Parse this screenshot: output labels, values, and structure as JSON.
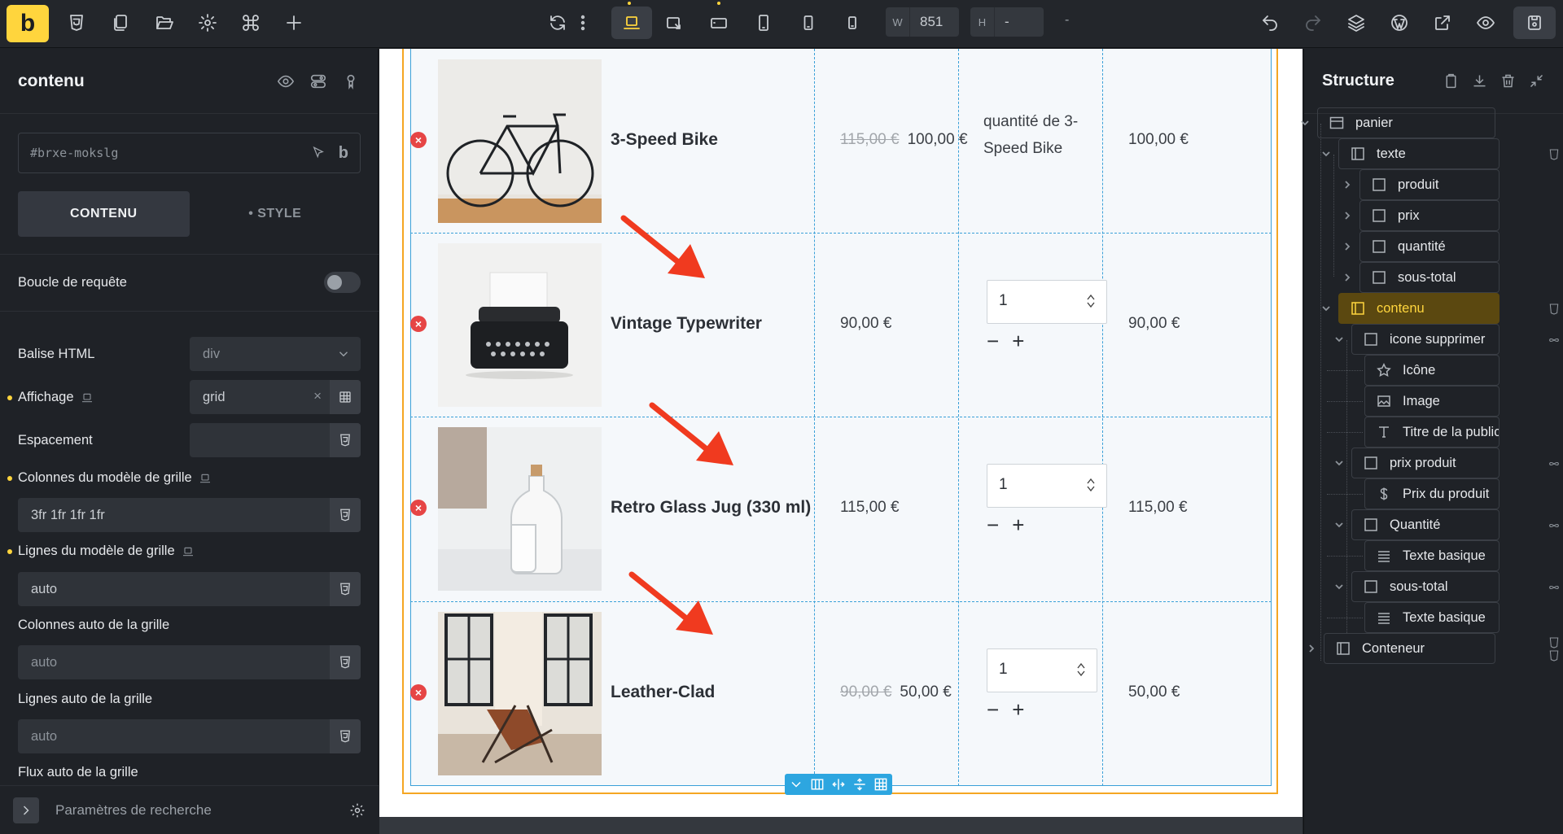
{
  "topbar": {
    "logo": "b",
    "width_key": "W",
    "width_value": "851",
    "height_key": "H",
    "height_value": "-",
    "separator": "-"
  },
  "left_panel": {
    "title": "contenu",
    "element_id": "#brxe-mokslg",
    "tab_content": "CONTENU",
    "tab_style": "• STYLE",
    "query_loop_label": "Boucle de requête",
    "html_tag_label": "Balise HTML",
    "html_tag_value": "div",
    "display_label": "Affichage",
    "display_value": "grid",
    "gap_label": "Espacement",
    "grid_columns_label": "Colonnes du modèle de grille",
    "grid_columns_value": "3fr 1fr 1fr 1fr",
    "grid_rows_label": "Lignes du modèle de grille",
    "grid_rows_value": "auto",
    "auto_columns_label": "Colonnes auto de la grille",
    "auto_columns_placeholder": "auto",
    "auto_rows_label": "Lignes auto de la grille",
    "auto_rows_placeholder": "auto",
    "auto_flow_label": "Flux auto de la grille",
    "footer_search": "Paramètres de recherche"
  },
  "cart": {
    "rows": [
      {
        "name": "3-Speed Bike",
        "old_price": "115,00 €",
        "price": "100,00 €",
        "quantity_text": "quantité de 3-Speed Bike",
        "subtotal": "100,00 €"
      },
      {
        "name": "Vintage Typewriter",
        "old_price": "",
        "price": "90,00 €",
        "quantity": "1",
        "subtotal": "90,00 €"
      },
      {
        "name": "Retro Glass Jug (330 ml)",
        "old_price": "",
        "price": "115,00 €",
        "quantity": "1",
        "subtotal": "115,00 €"
      },
      {
        "name": "Leather-Clad",
        "old_price": "90,00 €",
        "price": "50,00 €",
        "quantity": "1",
        "subtotal": "50,00 €"
      }
    ],
    "minus": "−",
    "plus": "+",
    "delete_glyph": "×",
    "arrow_color": "#f03a1f"
  },
  "structure": {
    "title": "Structure",
    "nodes": [
      {
        "label": "panier",
        "icon": "section-icon"
      },
      {
        "label": "texte",
        "icon": "block-icon"
      },
      {
        "label": "produit",
        "icon": "div-icon"
      },
      {
        "label": "prix",
        "icon": "div-icon"
      },
      {
        "label": "quantité",
        "icon": "div-icon"
      },
      {
        "label": "sous-total",
        "icon": "div-icon"
      },
      {
        "label": "contenu",
        "icon": "block-icon"
      },
      {
        "label": "icone supprimer",
        "icon": "div-icon"
      },
      {
        "label": "Icône",
        "icon": "star-icon"
      },
      {
        "label": "Image",
        "icon": "image-icon"
      },
      {
        "label": "Titre de la publication",
        "icon": "text-t-icon"
      },
      {
        "label": "prix produit",
        "icon": "div-icon"
      },
      {
        "label": "Prix du produit",
        "icon": "dollar-icon"
      },
      {
        "label": "Quantité",
        "icon": "div-icon"
      },
      {
        "label": "Texte basique",
        "icon": "lines-icon"
      },
      {
        "label": "sous-total",
        "icon": "div-icon"
      },
      {
        "label": "Texte basique",
        "icon": "lines-icon"
      },
      {
        "label": "Conteneur",
        "icon": "block-icon"
      }
    ]
  },
  "colors": {
    "accent": "#ffd53d",
    "grid_outline": "#3aa0d8",
    "wrapper_outline": "#f5a623",
    "delete": "#e64545"
  }
}
